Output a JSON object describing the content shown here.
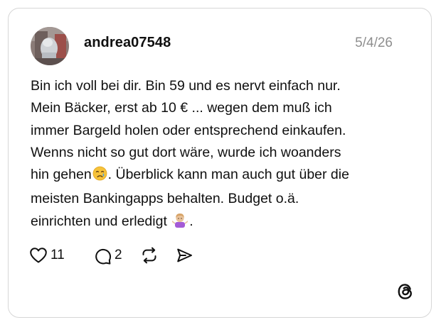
{
  "post": {
    "username": "andrea07548",
    "date": "5/4/26",
    "lines": [
      {
        "text": "Bin ich voll bei dir. Bin 59 und es nervt einfach nur."
      },
      {
        "text": "Mein Bäcker, erst ab 10 € ... wegen dem muß ich"
      },
      {
        "text": "immer Bargeld holen oder entsprechend einkaufen."
      },
      {
        "text": "Wenns nicht so gut dort wäre, wurde ich woanders"
      },
      {
        "before": "hin gehen",
        "emoji": "crying-face-emoji",
        "after": ". Überblick kann man auch gut über die"
      },
      {
        "text": "meisten Bankingapps behalten. Budget o.ä."
      },
      {
        "before": "einrichten und erledigt ",
        "emoji": "person-shrugging-emoji",
        "after": "."
      }
    ]
  },
  "actions": {
    "like_count": "11",
    "reply_count": "2",
    "icons": [
      "heart-icon",
      "comment-icon",
      "repost-icon",
      "share-icon"
    ]
  },
  "branding": {
    "logo": "threads-logo-icon"
  },
  "colors": {
    "text": "#101010",
    "muted": "#8e8e8e",
    "border": "#d6d6d6",
    "background": "#ffffff"
  }
}
